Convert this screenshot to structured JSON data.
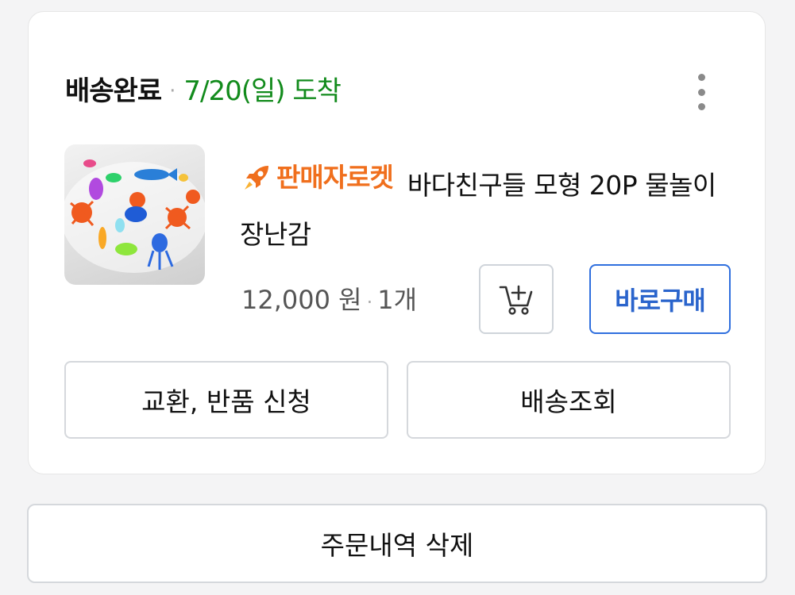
{
  "order": {
    "status": "배송완료",
    "separator": "·",
    "arrival": "7/20(일) 도착",
    "more_icon": "more-vertical-icon"
  },
  "product": {
    "badge": "판매자로켓",
    "badge_icon": "rocket-icon",
    "name": "바다친구들 모형 20P 물놀이 장난감",
    "price": "12,000 원",
    "separator": "·",
    "quantity": "1개",
    "image_alt": "바다친구들 모형 20P 물놀이 장난감"
  },
  "actions": {
    "cart_icon": "add-to-cart-icon",
    "buy_now": "바로구매",
    "exchange_return": "교환, 반품 신청",
    "track_delivery": "배송조회",
    "delete_order": "주문내역 삭제"
  },
  "colors": {
    "background": "#f4f4f5",
    "arrival_green": "#128b1c",
    "badge_orange": "#f06f1d",
    "buy_blue": "#2a64cc"
  }
}
